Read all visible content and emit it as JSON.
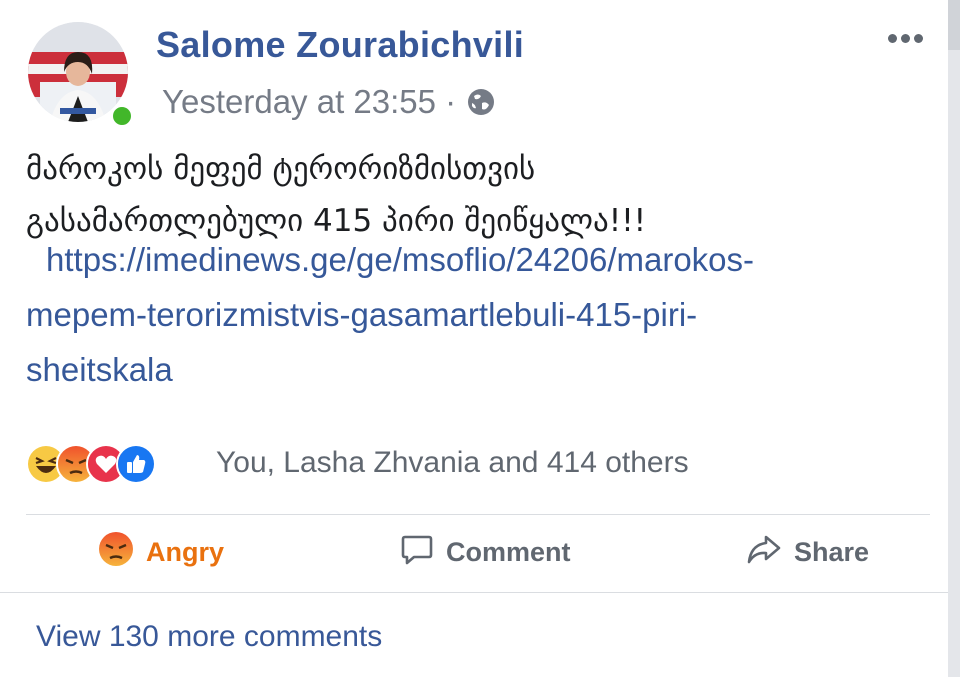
{
  "post": {
    "author": "Salome Zourabichvili",
    "timestamp": "Yesterday at 23:55 ·",
    "text_lines": [
      "მაროკოს მეფემ ტერორიზმისთვის",
      "გასამართლებული 415 პირი შეიწყალა!!!"
    ],
    "link_lines": [
      "https://imedinews.ge/ge/msoflio/24206/marokos-",
      "mepem-terorizmistvis-gasamartlebuli-415-piri-",
      "sheitskala"
    ]
  },
  "reactions": {
    "icons": [
      "haha-icon",
      "angry-icon",
      "love-icon",
      "like-icon"
    ],
    "summary": "You, Lasha Zhvania and 414 others"
  },
  "actions": {
    "angry_label": "Angry",
    "comment_label": "Comment",
    "share_label": "Share"
  },
  "comments": {
    "view_more_label": "View 130 more comments"
  },
  "colors": {
    "name_blue": "#385898",
    "link_blue": "#365899",
    "angry_orange": "#e9710f",
    "online_green": "#42b72a",
    "like_blue": "#1877f2",
    "love_red": "#e8334b"
  }
}
